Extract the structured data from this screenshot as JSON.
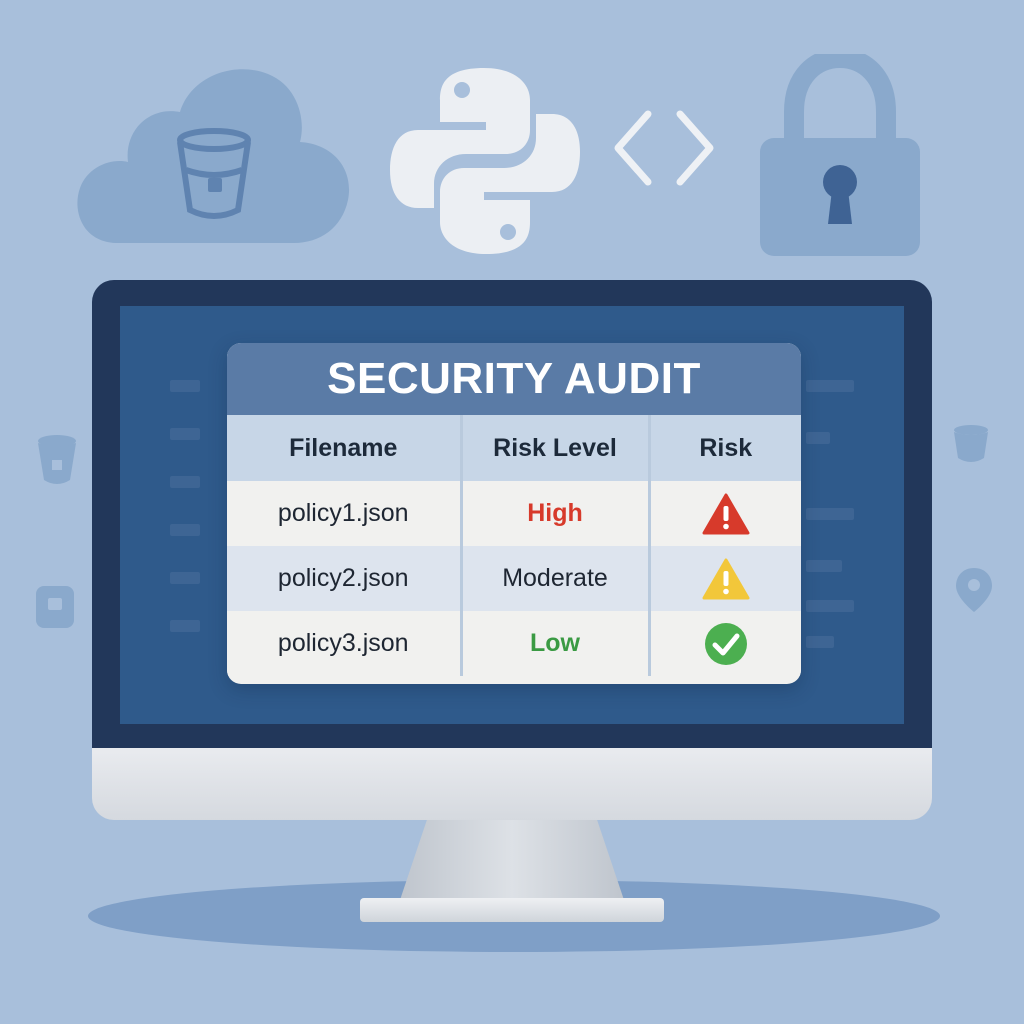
{
  "panel": {
    "title": "SECURITY AUDIT",
    "columns": [
      "Filename",
      "Risk Level",
      "Risk"
    ],
    "rows": [
      {
        "filename": "policy1.json",
        "risk_level": "High",
        "risk_icon": "warning-red-icon"
      },
      {
        "filename": "policy2.json",
        "risk_level": "Moderate",
        "risk_icon": "warning-yellow-icon"
      },
      {
        "filename": "policy3.json",
        "risk_level": "Low",
        "risk_icon": "check-green-icon"
      }
    ]
  },
  "decor_icons": [
    "cloud-bucket-icon",
    "python-icon",
    "code-brackets-icon",
    "padlock-icon",
    "bucket-icon",
    "location-pin-icon"
  ],
  "colors": {
    "background": "#a8bfdb",
    "high": "#d73a2b",
    "moderate": "#f2c73a",
    "low": "#3a9a43",
    "panel_header": "#5a7ba6"
  }
}
